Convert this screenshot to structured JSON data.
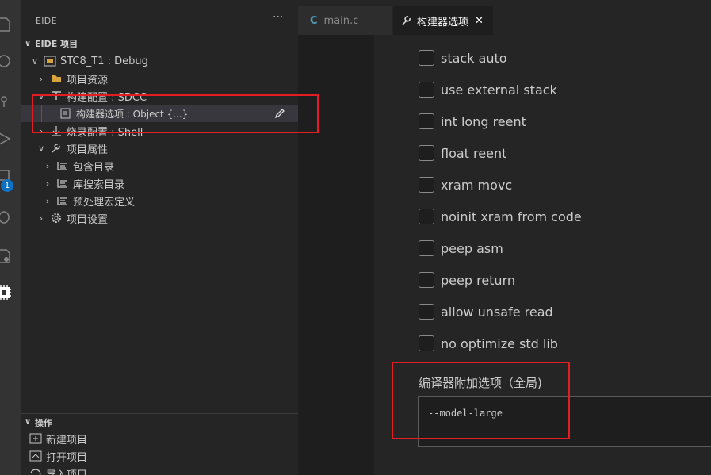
{
  "sidebar": {
    "title": "EIDE",
    "more": "···",
    "project_section": "EIDE 项目",
    "tree": [
      {
        "label": "STC8_T1 : Debug"
      },
      {
        "label": "项目资源"
      },
      {
        "label": "构建配置 : SDCC"
      },
      {
        "label": "构建器选项 : Object {...}"
      },
      {
        "label": "烧录配置 : Shell"
      },
      {
        "label": "项目属性"
      },
      {
        "label": "包含目录"
      },
      {
        "label": "库搜索目录"
      },
      {
        "label": "预处理宏定义"
      },
      {
        "label": "项目设置"
      }
    ],
    "ops_section": "操作",
    "ops": [
      {
        "label": "新建项目"
      },
      {
        "label": "打开项目"
      },
      {
        "label": "导入项目"
      }
    ]
  },
  "activity": {
    "badge": "1"
  },
  "tabs": [
    {
      "label": "main.c",
      "icon": "C"
    },
    {
      "label": "构建器选项",
      "close": "✕"
    }
  ],
  "options": [
    {
      "label": "stack auto",
      "checked": false
    },
    {
      "label": "use external stack",
      "checked": false
    },
    {
      "label": "int long reent",
      "checked": false
    },
    {
      "label": "float reent",
      "checked": false
    },
    {
      "label": "xram movc",
      "checked": false
    },
    {
      "label": "noinit xram from code",
      "checked": false
    },
    {
      "label": "peep asm",
      "checked": false
    },
    {
      "label": "peep return",
      "checked": false
    },
    {
      "label": "allow unsafe read",
      "checked": false
    },
    {
      "label": "no optimize std lib",
      "checked": false
    }
  ],
  "global_options": {
    "label": "编译器附加选项（全局)",
    "value": "--model-large"
  },
  "colors": {
    "accent": "#0e70c0",
    "annotation": "#e51c23"
  }
}
